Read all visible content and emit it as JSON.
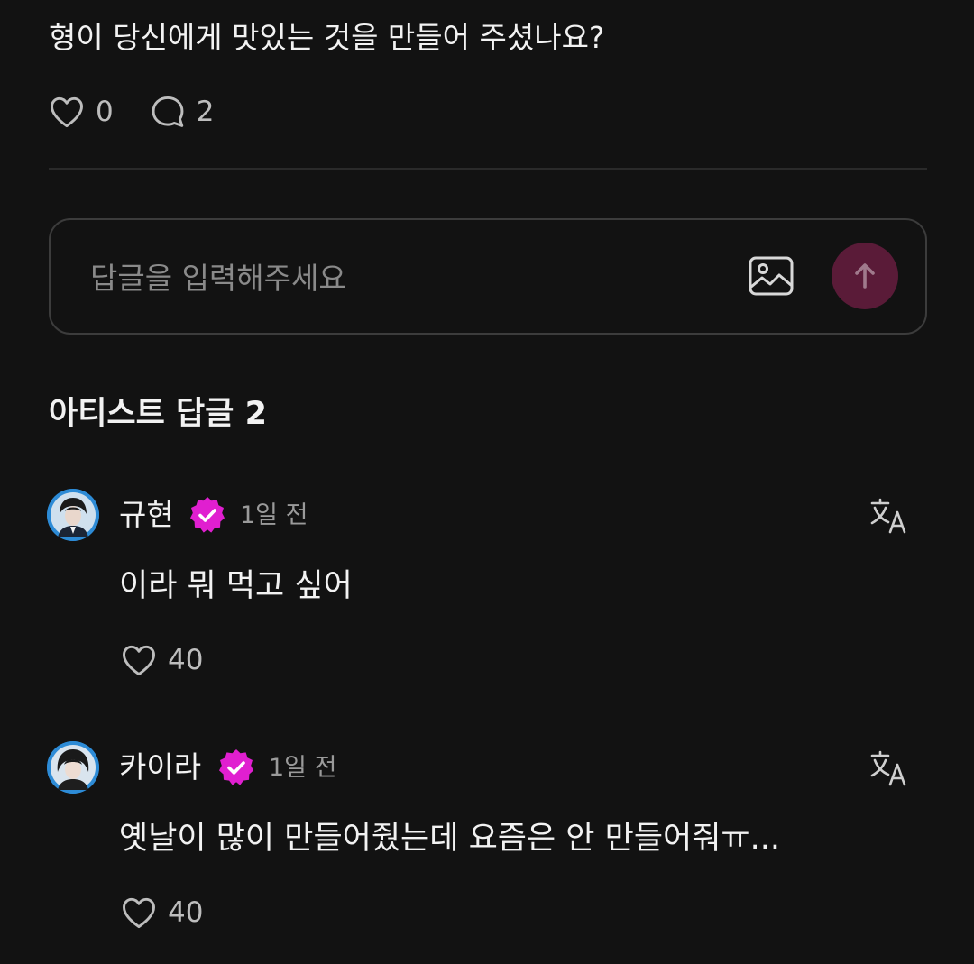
{
  "post": {
    "text": "형이 당신에게 맛있는 것을 만들어 주셨나요?",
    "like_count": "0",
    "comment_count": "2"
  },
  "reply_input": {
    "placeholder": "답글을 입력해주세요"
  },
  "section": {
    "title": "아티스트 답글 2"
  },
  "comments": [
    {
      "author": "규현",
      "time": "1일 전",
      "body": "이라 뭐 먹고 싶어",
      "like_count": "40"
    },
    {
      "author": "카이라",
      "time": "1일 전",
      "body": "옛날이 많이 만들어줬는데 요즘은 안 만들어줘ㅠ...",
      "like_count": "40"
    }
  ],
  "icons": {
    "like": "heart-outline-icon",
    "comment": "speech-bubble-icon",
    "image": "image-icon",
    "send": "arrow-up-icon",
    "verified": "verified-badge-icon",
    "translate": "translate-icon"
  },
  "colors": {
    "background": "#121212",
    "send_button": "#5a1b38",
    "verified_badge": "#e01fd0",
    "avatar_ring": "#2d8bd6"
  }
}
